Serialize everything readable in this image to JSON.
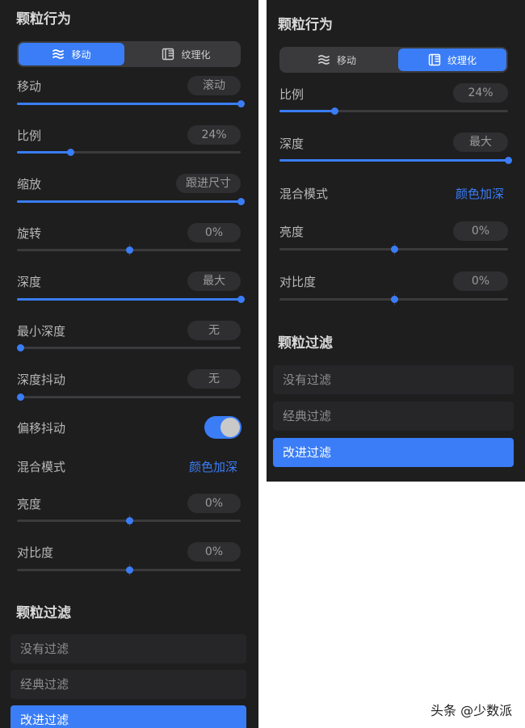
{
  "colors": {
    "accent": "#3a7df6",
    "panel_bg": "#1e1e1f",
    "text": "#b8b8b8",
    "pill_bg": "#2f2f31"
  },
  "left_panel": {
    "title": "颗粒行为",
    "tabs": [
      {
        "label": "移动",
        "icon": "waves-icon",
        "active": true
      },
      {
        "label": "纹理化",
        "icon": "texture-grid-icon",
        "active": false
      }
    ],
    "settings": [
      {
        "label": "移动",
        "value": "滚动",
        "slider": 1.0
      },
      {
        "label": "比例",
        "value": "24%",
        "slider": 0.24
      },
      {
        "label": "缩放",
        "value": "跟进尺寸",
        "slider": 1.0
      },
      {
        "label": "旋转",
        "value": "0%",
        "slider": 0.5,
        "centered": true
      },
      {
        "label": "深度",
        "value": "最大",
        "slider": 1.0
      },
      {
        "label": "最小深度",
        "value": "无",
        "slider": 0.0
      },
      {
        "label": "深度抖动",
        "value": "无",
        "slider": 0.0
      }
    ],
    "offset_jitter": {
      "label": "偏移抖动",
      "on": true
    },
    "blend_mode": {
      "label": "混合模式",
      "value": "颜色加深"
    },
    "brightness": {
      "label": "亮度",
      "value": "0%",
      "slider": 0.5
    },
    "contrast": {
      "label": "对比度",
      "value": "0%",
      "slider": 0.5
    },
    "filter_title": "颗粒过滤",
    "filters": [
      {
        "label": "没有过滤",
        "active": false
      },
      {
        "label": "经典过滤",
        "active": false
      },
      {
        "label": "改进过滤",
        "active": true
      }
    ]
  },
  "right_panel": {
    "title": "颗粒行为",
    "tabs": [
      {
        "label": "移动",
        "icon": "waves-icon",
        "active": false
      },
      {
        "label": "纹理化",
        "icon": "texture-grid-icon",
        "active": true
      }
    ],
    "settings": [
      {
        "label": "比例",
        "value": "24%",
        "slider": 0.24
      },
      {
        "label": "深度",
        "value": "最大",
        "slider": 1.0
      }
    ],
    "blend_mode": {
      "label": "混合模式",
      "value": "颜色加深"
    },
    "brightness": {
      "label": "亮度",
      "value": "0%",
      "slider": 0.5
    },
    "contrast": {
      "label": "对比度",
      "value": "0%",
      "slider": 0.5
    },
    "filter_title": "颗粒过滤",
    "filters": [
      {
        "label": "没有过滤",
        "active": false
      },
      {
        "label": "经典过滤",
        "active": false
      },
      {
        "label": "改进过滤",
        "active": true
      }
    ]
  },
  "watermark": "头条 @少数派"
}
